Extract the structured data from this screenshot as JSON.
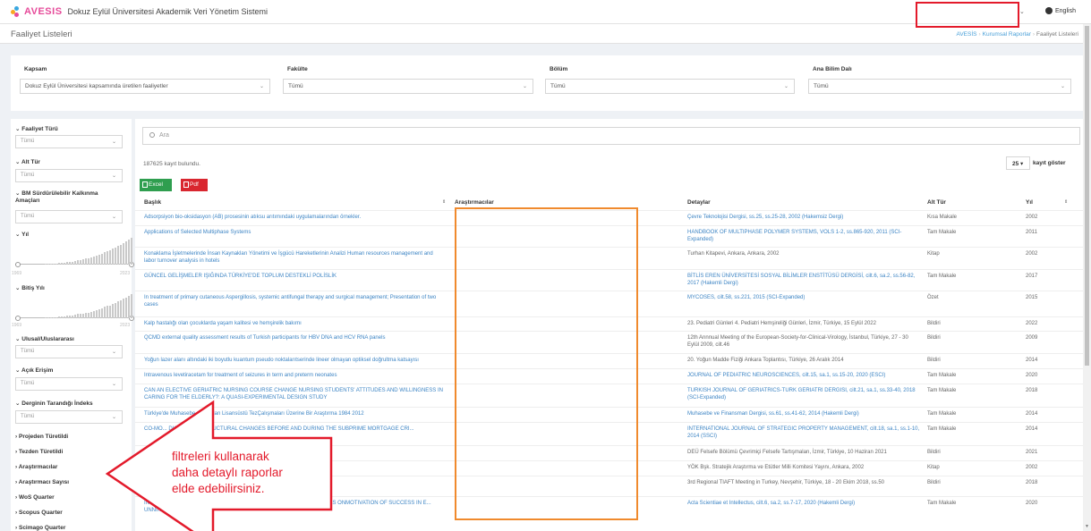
{
  "header": {
    "logo_text": "AVESIS",
    "app_title": "Dokuz Eylül Üniversitesi Akademik Veri Yönetim Sistemi",
    "language": "English"
  },
  "page": {
    "title": "Faaliyet Listeleri",
    "breadcrumb": [
      "AVESİS",
      "Kurumsal Raporlar",
      "Faaliyet Listeleri"
    ]
  },
  "filters": [
    {
      "label": "Kapsam",
      "value": "Dokuz Eylül Üniversitesi kapsamında üretilen faaliyetler"
    },
    {
      "label": "Fakülte",
      "value": "Tümü"
    },
    {
      "label": "Bölüm",
      "value": "Tümü"
    },
    {
      "label": "Ana Bilim Dalı",
      "value": "Tümü"
    }
  ],
  "sidebar": {
    "faaliyet_turu": {
      "label": "Faaliyet Türü",
      "value": "Tümü"
    },
    "alt_tur": {
      "label": "Alt Tür",
      "value": "Tümü"
    },
    "bm": {
      "label": "BM Sürdürülebilir Kalkınma Amaçları",
      "value": "Tümü"
    },
    "yil": {
      "label": "Yıl",
      "min": "1969",
      "max": "2023"
    },
    "bitis_yili": {
      "label": "Bitiş Yılı",
      "min": "1969",
      "max": "2023"
    },
    "ulusal": {
      "label": "Ulusal/Uluslararası",
      "value": "Tümü"
    },
    "acik_erisim": {
      "label": "Açık Erişim",
      "value": "Tümü"
    },
    "indeks": {
      "label": "Derginin Tarandığı İndeks",
      "value": "Tümü"
    },
    "collapsed": [
      "Projeden Türetildi",
      "Tezden Türetildi",
      "Araştırmacılar",
      "Araştırmacı Sayısı",
      "WoS Quarter",
      "Scopus Quarter",
      "Scimago Quarter"
    ]
  },
  "main": {
    "search_placeholder": "Ara",
    "found_text": "187625 kayıt bulundu.",
    "page_size": "25",
    "page_size_suffix": "kayıt göster",
    "excel_label": "Excel",
    "pdf_label": "Pdf",
    "columns": {
      "title": "Başlık",
      "researchers": "Araştırmacılar",
      "details": "Detaylar",
      "subtype": "Alt Tür",
      "year": "Yıl"
    },
    "rows": [
      {
        "title": "Adsorpsiyon bio-oksidasyon (AB) prosesinin atıksu arıtımındaki uygulamalarından örnekler.",
        "details": "Çevre Teknolojisi Dergisi, ss.25, ss.25-28, 2002 (Hakemsiz Dergi)",
        "subtype": "Kısa Makale",
        "year": "2002"
      },
      {
        "title": "Applications of Selected Multiphase Systems",
        "details": "HANDBOOK OF MULTIPHASE POLYMER SYSTEMS, VOLS 1-2, ss.865-920, 2011 (SCI-Expanded)",
        "subtype": "Tam Makale",
        "year": "2011"
      },
      {
        "title": "Konaklama İşletmelerinde İnsan Kaynakları Yönetimi ve İşgücü Hareketlerinin Analizi Human resources management and labor turnover analysis in hotels",
        "details": "Turhan Kitapevi, Ankara, Ankara, 2002",
        "subtype": "Kitap",
        "year": "2002"
      },
      {
        "title": "GÜNCEL GELİŞMELER IŞIĞINDA TÜRKİYE'DE TOPLUM DESTEKLİ POLİSLİK",
        "details": "BİTLİS EREN ÜNİVERSİTESİ SOSYAL BİLİMLER ENSTİTÜSÜ DERGİSİ, cilt.6, sa.2, ss.56-82, 2017 (Hakemli Dergi)",
        "subtype": "Tam Makale",
        "year": "2017"
      },
      {
        "title": "In treatment of primary cutaneous Aspergillosis, systemic antifungal therapy and surgical management; Presentation of two cases",
        "details": "MYCOSES, cilt.58, ss.221, 2015 (SCI-Expanded)",
        "subtype": "Özet",
        "year": "2015"
      },
      {
        "title": "Kalp hastalığı olan çocuklarda yaşam kalitesi ve hemşirelik bakımı",
        "details": "23. Pediatri Günleri 4. Pediatri Hemşireliği Günleri, İzmir, Türkiye, 15 Eylül 2022",
        "subtype": "Bildiri",
        "year": "2022"
      },
      {
        "title": "QCMD external quality assessment results of Turkish participants for HBV DNA and HCV RNA panels",
        "details": "12th Annnual Meeting of the European-Society-for-Clinical-Virology, İstanbul, Türkiye, 27 - 30 Eylül 2009, cilt.46",
        "subtype": "Bildiri",
        "year": "2009"
      },
      {
        "title": "Yoğun lazer alanı altındaki iki boyutlu kuantum pseudo noktalarıtserinde lineer olmayan optiksel doğrultma katsayısı",
        "details": "20. Yoğun Madde Fiziği Ankara Toplantısı, Türkiye, 26 Aralık 2014",
        "subtype": "Bildiri",
        "year": "2014"
      },
      {
        "title": "Intravenous levetiracetam for treatment of seizures in term and preterm neonates",
        "details": "JOURNAL OF PEDIATRIC NEUROSCIENCES, cilt.15, sa.1, ss.15-20, 2020 (ESCI)",
        "subtype": "Tam Makale",
        "year": "2020"
      },
      {
        "title": "CAN AN ELECTIVE GERIATRIC NURSING COURSE CHANGE NURSING STUDENTS' ATTITUDES AND WILLINGNESS IN CARING FOR THE ELDERLY?: A QUASI-EXPERIMENTAL DESIGN STUDY",
        "details": "TURKISH JOURNAL OF GERIATRICS-TURK GERIATRI DERGISI, cilt.21, sa.1, ss.33-40, 2018 (SCI-Expanded)",
        "subtype": "Tam Makale",
        "year": "2018"
      },
      {
        "title": "Türkiye'de Muhasebe ... Yapılan Lisansüstü TezÇalışmaları Üzerine Bir Araştırma 1984 2012",
        "details": "Muhasebe ve Finansman Dergisi, ss.61, ss.41-62, 2014 (Hakemli Dergi)",
        "subtype": "Tam Makale",
        "year": "2014"
      },
      {
        "title": "CO-MO... DICES WITH STRUCTURAL CHANGES BEFORE AND DURING THE SUBPRIME MORTGAGE CRI...",
        "details": "INTERNATIONAL JOURNAL OF STRATEGIC PROPERTY MANAGEMENT, cilt.18, sa.1, ss.1-10, 2014 (SSCI)",
        "subtype": "Tam Makale",
        "year": "2014"
      },
      {
        "title": "",
        "details": "DEÜ Felsefe Bölümü Çevrimiçi Felsefe Tartışmaları, İzmir, Türkiye, 10 Haziran 2021",
        "subtype": "Bildiri",
        "year": "2021"
      },
      {
        "title": "...stan a Katılması",
        "details": "YÖK Bşk. Stratejik Araştırma ve Etütler Milli Komitesi Yayını, Ankara, 2002",
        "subtype": "Kitap",
        "year": "2002"
      },
      {
        "title": "...University drug and poison information",
        "details": "3rd Regional TIAFT Meeting in Turkey, Nevşehir, Türkiye, 18 - 20 Ekim 2018, ss.50",
        "subtype": "Bildiri",
        "year": "2018"
      },
      {
        "title": "INVESTIG... OF POSITIVEPERCEPTION AND MENTAL TOUGHNESS LEVELS ONMOTIVATION OF SUCCESS IN E... UNNING ATHLETES",
        "details": "Acta Scientiae et Intellectus, cilt.6, sa.2, ss.7-17, 2020 (Hakemli Dergi)",
        "subtype": "Tam Makale",
        "year": "2020"
      }
    ]
  },
  "annotation": {
    "callout_lines": [
      "filtreleri kullanarak",
      "daha detaylı raporlar",
      "elde edebilirsiniz."
    ],
    "color": "#e31a2b",
    "orange_box_color": "#f08a2d"
  }
}
